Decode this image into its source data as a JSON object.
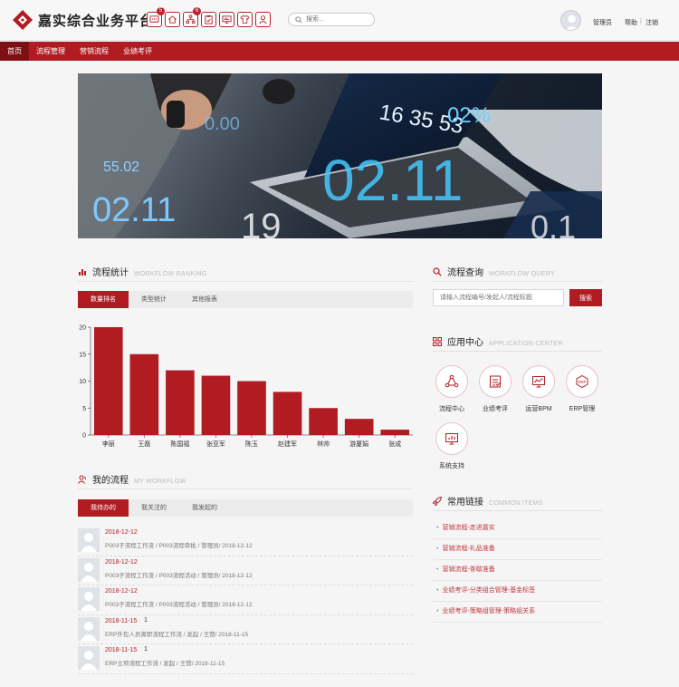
{
  "header": {
    "title": "嘉实综合业务平台",
    "search_placeholder": "搜索...",
    "user_name": "管理员",
    "help": "帮助",
    "separator": "|",
    "logout": "注销",
    "icons": [
      {
        "name": "message-icon",
        "badge": "5"
      },
      {
        "name": "home-icon",
        "badge": ""
      },
      {
        "name": "org-chart-icon",
        "badge": "6"
      },
      {
        "name": "clipboard-icon",
        "badge": ""
      },
      {
        "name": "monitor-icon",
        "badge": ""
      },
      {
        "name": "shirt-icon",
        "badge": ""
      },
      {
        "name": "user-icon",
        "badge": ""
      }
    ]
  },
  "nav": [
    "首页",
    "流程管理",
    "营销流程",
    "业绩考评"
  ],
  "banner_numbers": [
    "55.02",
    "0.00",
    "02.11",
    "16 35 53",
    "02%",
    "02.11",
    "19",
    "0.1"
  ],
  "stats": {
    "title": "流程统计",
    "subtitle": "WORKFLOW RANKING",
    "tabs": [
      "数量排名",
      "类型统计",
      "其他报表"
    ]
  },
  "chart_data": {
    "type": "bar",
    "categories": [
      "李丽",
      "王磊",
      "陈国福",
      "张亚军",
      "陈玉",
      "赵建军",
      "林帅",
      "游厦娟",
      "张成"
    ],
    "values": [
      20,
      15,
      12,
      11,
      10,
      8,
      5,
      3,
      1
    ],
    "ylim": [
      0,
      20
    ],
    "yticks": [
      "0",
      "5",
      "10",
      "15",
      "20"
    ],
    "color": "#b01c22"
  },
  "my_workflow": {
    "title": "我的流程",
    "subtitle": "MY WORKFLOW",
    "tabs": [
      "我待办的",
      "我关注的",
      "我发起的"
    ],
    "items": [
      {
        "date": "2018-12-12",
        "count": "",
        "desc": "P003子流程工作流 / P003流程审批 / 管理员/ 2018-12-12"
      },
      {
        "date": "2018-12-12",
        "count": "",
        "desc": "P003子流程工作流 / P003流程活动 / 管理员/ 2018-12-12"
      },
      {
        "date": "2018-12-12",
        "count": "",
        "desc": "P003子流程工作流 / P003流程活动 / 管理员/ 2018-12-12"
      },
      {
        "date": "2018-11-15",
        "count": "1",
        "desc": "ERP外包人员离职流程工作流 / 发起 / 王赞/ 2018-11-15"
      },
      {
        "date": "2018-11-15",
        "count": "1",
        "desc": "ERP立项流程工作流 / 发起 / 王赞/ 2018-11-15"
      }
    ]
  },
  "query": {
    "title": "流程查询",
    "subtitle": "WORKFLOW QUERY",
    "placeholder": "请输入流程编号/发起人/流程标题",
    "button": "搜索"
  },
  "app_center": {
    "title": "应用中心",
    "subtitle": "APPLICATION CENTER",
    "apps": [
      {
        "label": "流程中心",
        "icon": "workflow-icon"
      },
      {
        "label": "业绩考评",
        "icon": "evaluation-icon"
      },
      {
        "label": "运营BPM",
        "icon": "bpm-icon"
      },
      {
        "label": "ERP管理",
        "icon": "erp-icon"
      },
      {
        "label": "系统支持",
        "icon": "system-support-icon"
      }
    ]
  },
  "common": {
    "title": "常用链接",
    "subtitle": "COMMON ITEMS",
    "links": [
      "营销流程-走进嘉实",
      "营销流程-礼品准备",
      "营销流程-茶歇准备",
      "业绩考评-分类组合管理-基金标签",
      "业绩考评-策略组管理-策略组关系"
    ]
  }
}
